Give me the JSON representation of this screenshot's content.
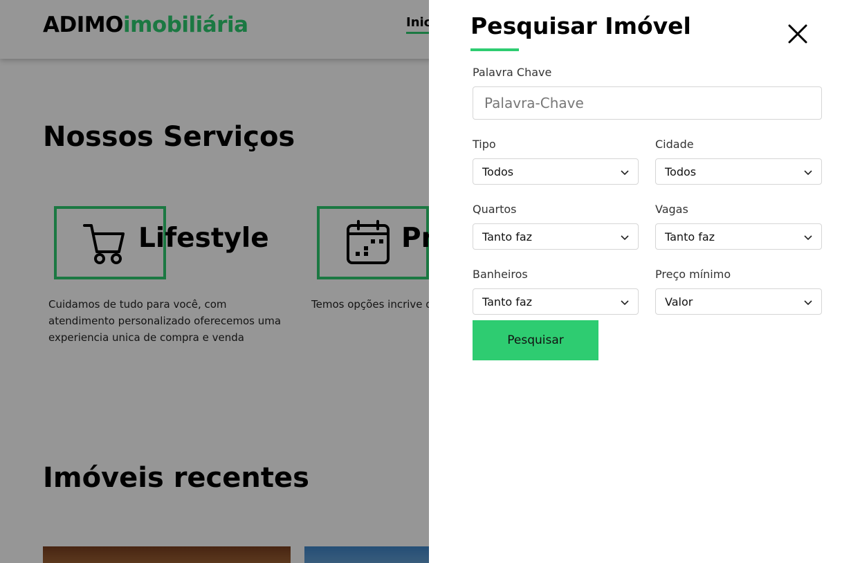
{
  "header": {
    "logo_brand": "ADIMO",
    "logo_accent": "imobiliária",
    "nav_item": "Inic"
  },
  "services": {
    "title": "Nossos Serviços",
    "cards": [
      {
        "icon": "cart-icon",
        "title": "Lifestyle",
        "text": "Cuidamos de tudo para você, com atendimento personalizado oferecemos uma experiencia unica de compra e venda"
      },
      {
        "icon": "calendar-icon",
        "title": "Pr",
        "text": "Temos opções incrive que cabem no seu bo"
      }
    ]
  },
  "recent": {
    "title": "Imóveis recentes"
  },
  "search_panel": {
    "title": "Pesquisar Imóvel",
    "keyword": {
      "label": "Palavra Chave",
      "placeholder": "Palavra-Chave",
      "value": ""
    },
    "tipo": {
      "label": "Tipo",
      "value": "Todos"
    },
    "cidade": {
      "label": "Cidade",
      "value": "Todos"
    },
    "quartos": {
      "label": "Quartos",
      "value": "Tanto faz"
    },
    "vagas": {
      "label": "Vagas",
      "value": "Tanto faz"
    },
    "banheiros": {
      "label": "Banheiros",
      "value": "Tanto faz"
    },
    "preco_minimo": {
      "label": "Preço mínimo",
      "value": "Valor"
    },
    "submit_label": "Pesquisar"
  },
  "colors": {
    "accent": "#2ecc71",
    "overlay": "rgba(0,0,0,0.41)",
    "text": "#000000"
  }
}
